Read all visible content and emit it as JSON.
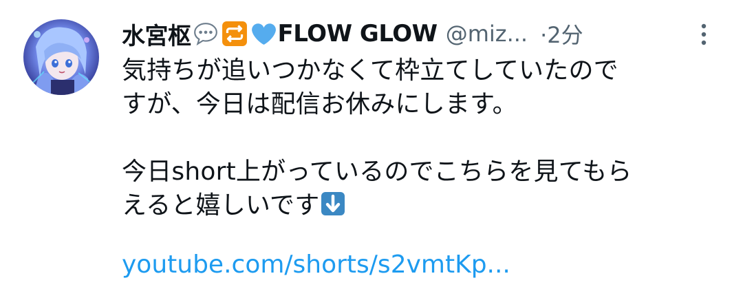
{
  "tweet": {
    "author": {
      "display_name": "水宮枢",
      "name_emojis": [
        "speech-balloon",
        "repeat-arrows",
        "blue-heart"
      ],
      "name_suffix": "FLOW GLOW",
      "handle": "@miz...",
      "avatar_icon": "avatar-image"
    },
    "time": "·2分",
    "more_icon": "more-vertical-icon",
    "text_lines": [
      "気持ちが追いつかなくて枠立てしていたので",
      "すが、今日は配信お休みにします。",
      "",
      "今日short上がっているのでこちらを見てもら",
      "えると嬉しいです"
    ],
    "trailing_emoji": "down-arrow-emoji",
    "link": "youtube.com/shorts/s2vmtKp...",
    "colors": {
      "text": "#0f1419",
      "secondary": "#536471",
      "link": "#1d9bf0",
      "emoji_blue": "#55acee",
      "emoji_orange": "#f4900c"
    }
  }
}
